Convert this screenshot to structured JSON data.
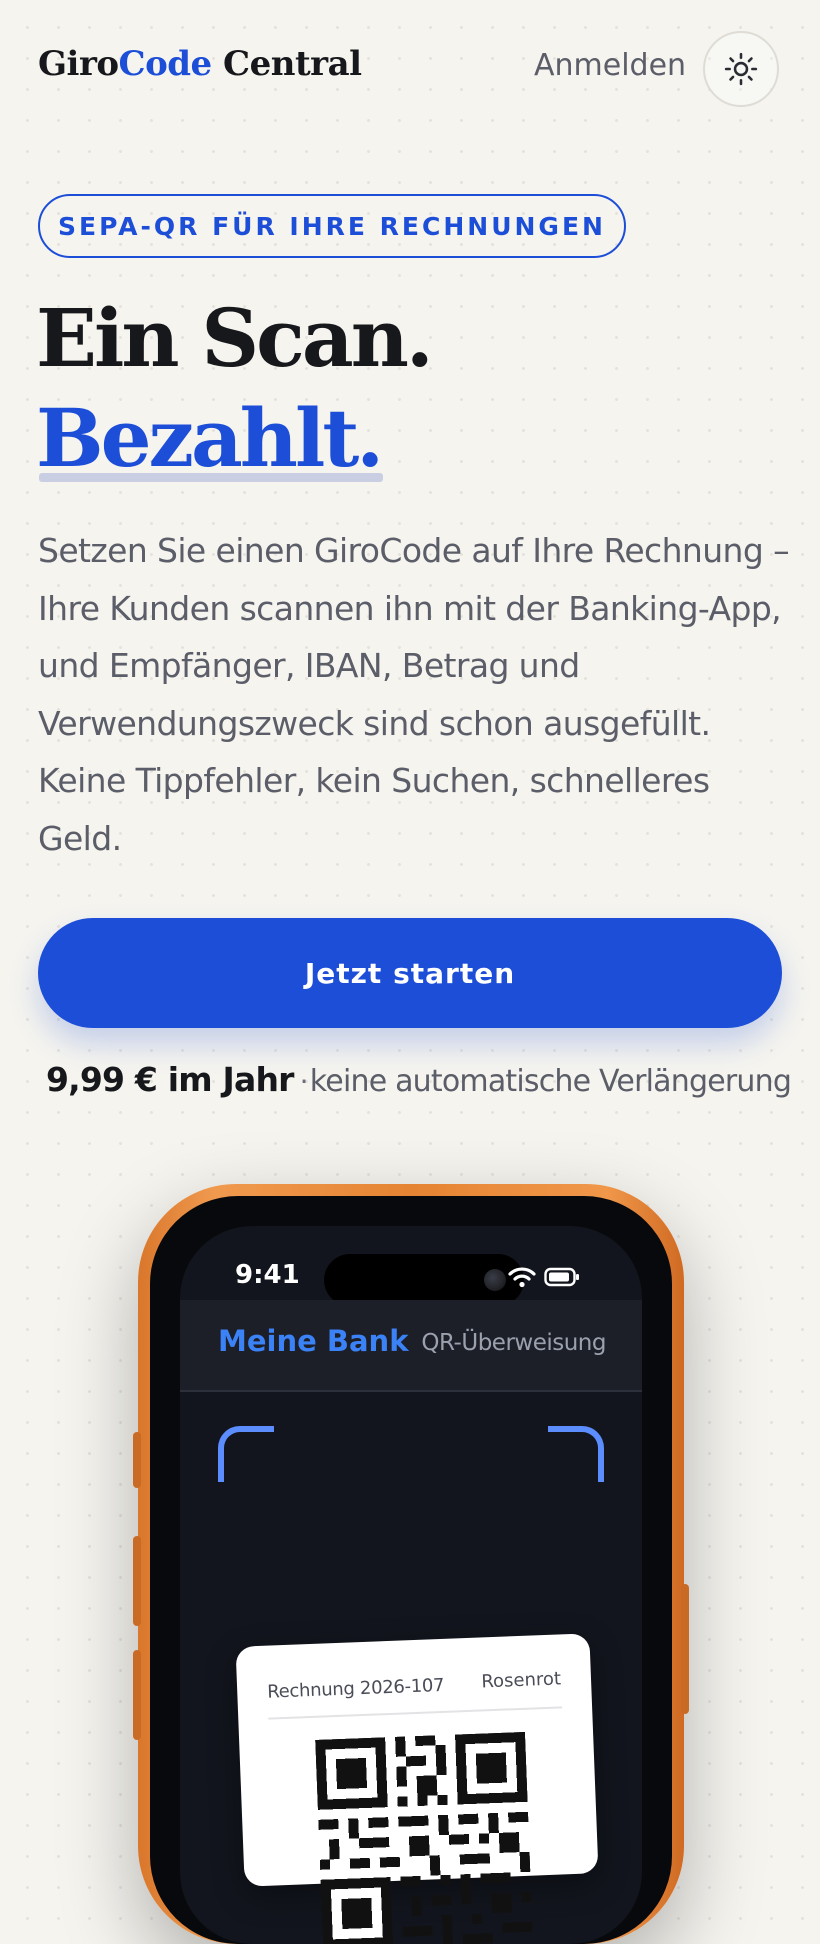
{
  "header": {
    "logo_part1": "Giro",
    "logo_part2": "Code",
    "logo_part3": " Central",
    "login_label": "Anmelden",
    "theme_toggle_icon": "sun-icon"
  },
  "hero": {
    "eyebrow": "SEPA-QR FÜR IHRE RECHNUNGEN",
    "headline_line1": "Ein Scan.",
    "headline_line2": "Bezahlt.",
    "intro": "Setzen Sie einen GiroCode auf Ihre Rechnung – Ihre Kunden scannen ihn mit der Banking-App, und Empfänger, IBAN, Betrag und Verwendungszweck sind schon ausgefüllt. Keine Tippfehler, kein Suchen, schnelleres Geld.",
    "cta_label": "Jetzt starten",
    "price": "9,99 € im Jahr",
    "price_separator": "·",
    "price_note": "keine automatische Verlängerung"
  },
  "phone": {
    "status_time": "9:41",
    "status_icons": [
      "wifi-icon",
      "battery-icon"
    ],
    "app_title": "Meine Bank",
    "screen_title": "QR-Überweisung",
    "invoice_number": "Rechnung 2026-107",
    "invoice_recipient": "Rosenrot"
  },
  "colors": {
    "accent": "#1d4ed8",
    "background": "#f5f4ef",
    "phone_frame": "#e58432",
    "phone_screen": "#12151d"
  }
}
